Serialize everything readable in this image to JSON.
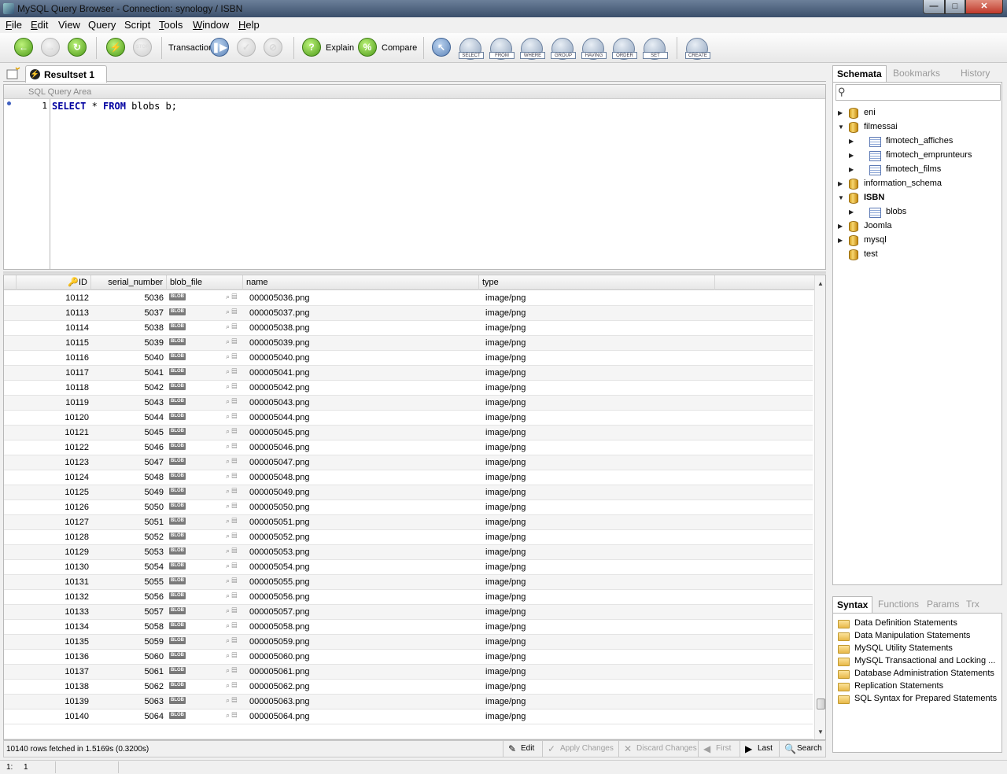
{
  "window": {
    "title": "MySQL Query Browser - Connection: synology / ISBN",
    "controls": {
      "minimize": "—",
      "maximize": "□",
      "close": "✕"
    }
  },
  "menu": [
    {
      "label": "File",
      "mnemonic": "F",
      "rest": "ile"
    },
    {
      "label": "Edit",
      "mnemonic": "E",
      "rest": "dit"
    },
    {
      "label": "View",
      "mnemonic": "",
      "rest": "View"
    },
    {
      "label": "Query",
      "mnemonic": "",
      "rest": "Query"
    },
    {
      "label": "Script",
      "mnemonic": "",
      "rest": "Script"
    },
    {
      "label": "Tools",
      "mnemonic": "T",
      "rest": "ools"
    },
    {
      "label": "Window",
      "mnemonic": "W",
      "rest": "indow"
    },
    {
      "label": "Help",
      "mnemonic": "H",
      "rest": "elp"
    }
  ],
  "toolbar": {
    "transaction_label": "Transaction",
    "explain_label": "Explain",
    "compare_label": "Compare",
    "stop_label": "STOP",
    "clauses": [
      "SELECT",
      "FROM",
      "WHERE",
      "GROUP",
      "HAVING",
      "ORDER",
      "SET"
    ],
    "create_label": "CREATE"
  },
  "tabs": {
    "resultset_label": "Resultset 1"
  },
  "sql_area": {
    "header_label": "SQL Query Area",
    "line_number": "1",
    "query_kw1": "SELECT",
    "query_mid": " * ",
    "query_kw2": "FROM",
    "query_rest": " blobs b;"
  },
  "grid": {
    "columns": [
      "ID",
      "serial_number",
      "blob_file",
      "name",
      "type"
    ],
    "blob_badge": "BLOB",
    "rows": [
      [
        "10112",
        "5036",
        "000005036.png",
        "image/png"
      ],
      [
        "10113",
        "5037",
        "000005037.png",
        "image/png"
      ],
      [
        "10114",
        "5038",
        "000005038.png",
        "image/png"
      ],
      [
        "10115",
        "5039",
        "000005039.png",
        "image/png"
      ],
      [
        "10116",
        "5040",
        "000005040.png",
        "image/png"
      ],
      [
        "10117",
        "5041",
        "000005041.png",
        "image/png"
      ],
      [
        "10118",
        "5042",
        "000005042.png",
        "image/png"
      ],
      [
        "10119",
        "5043",
        "000005043.png",
        "image/png"
      ],
      [
        "10120",
        "5044",
        "000005044.png",
        "image/png"
      ],
      [
        "10121",
        "5045",
        "000005045.png",
        "image/png"
      ],
      [
        "10122",
        "5046",
        "000005046.png",
        "image/png"
      ],
      [
        "10123",
        "5047",
        "000005047.png",
        "image/png"
      ],
      [
        "10124",
        "5048",
        "000005048.png",
        "image/png"
      ],
      [
        "10125",
        "5049",
        "000005049.png",
        "image/png"
      ],
      [
        "10126",
        "5050",
        "000005050.png",
        "image/png"
      ],
      [
        "10127",
        "5051",
        "000005051.png",
        "image/png"
      ],
      [
        "10128",
        "5052",
        "000005052.png",
        "image/png"
      ],
      [
        "10129",
        "5053",
        "000005053.png",
        "image/png"
      ],
      [
        "10130",
        "5054",
        "000005054.png",
        "image/png"
      ],
      [
        "10131",
        "5055",
        "000005055.png",
        "image/png"
      ],
      [
        "10132",
        "5056",
        "000005056.png",
        "image/png"
      ],
      [
        "10133",
        "5057",
        "000005057.png",
        "image/png"
      ],
      [
        "10134",
        "5058",
        "000005058.png",
        "image/png"
      ],
      [
        "10135",
        "5059",
        "000005059.png",
        "image/png"
      ],
      [
        "10136",
        "5060",
        "000005060.png",
        "image/png"
      ],
      [
        "10137",
        "5061",
        "000005061.png",
        "image/png"
      ],
      [
        "10138",
        "5062",
        "000005062.png",
        "image/png"
      ],
      [
        "10139",
        "5063",
        "000005063.png",
        "image/png"
      ],
      [
        "10140",
        "5064",
        "000005064.png",
        "image/png"
      ]
    ]
  },
  "result_status": {
    "text": "10140 rows fetched in 1.5169s (0.3200s)",
    "edit": "Edit",
    "apply": "Apply Changes",
    "discard": "Discard Changes",
    "first": "First",
    "last": "Last",
    "search": "Search"
  },
  "right_tabs": {
    "schemata": "Schemata",
    "bookmarks": "Bookmarks",
    "history": "History"
  },
  "schema_tree": [
    {
      "label": "eni",
      "kind": "db",
      "level": 0,
      "toggle": "right",
      "bold": false
    },
    {
      "label": "filmessai",
      "kind": "db",
      "level": 0,
      "toggle": "down",
      "bold": false
    },
    {
      "label": "fimotech_affiches",
      "kind": "table",
      "level": 1,
      "toggle": "right",
      "bold": false
    },
    {
      "label": "fimotech_emprunteurs",
      "kind": "table",
      "level": 1,
      "toggle": "right",
      "bold": false
    },
    {
      "label": "fimotech_films",
      "kind": "table",
      "level": 1,
      "toggle": "right",
      "bold": false
    },
    {
      "label": "information_schema",
      "kind": "db",
      "level": 0,
      "toggle": "right",
      "bold": false
    },
    {
      "label": "ISBN",
      "kind": "db",
      "level": 0,
      "toggle": "down",
      "bold": true
    },
    {
      "label": "blobs",
      "kind": "table",
      "level": 1,
      "toggle": "right",
      "bold": false
    },
    {
      "label": "Joomla",
      "kind": "db",
      "level": 0,
      "toggle": "right",
      "bold": false
    },
    {
      "label": "mysql",
      "kind": "db",
      "level": 0,
      "toggle": "right",
      "bold": false
    },
    {
      "label": "test",
      "kind": "db",
      "level": 0,
      "toggle": "none",
      "bold": false
    }
  ],
  "syntax_tabs": {
    "syntax": "Syntax",
    "functions": "Functions",
    "params": "Params",
    "trx": "Trx"
  },
  "syntax_items": [
    "Data Definition Statements",
    "Data Manipulation Statements",
    "MySQL Utility Statements",
    "MySQL Transactional and Locking ...",
    "Database Administration Statements",
    "Replication Statements",
    "SQL Syntax for Prepared Statements"
  ],
  "bottom_status": {
    "line": "1:",
    "col": "1"
  }
}
